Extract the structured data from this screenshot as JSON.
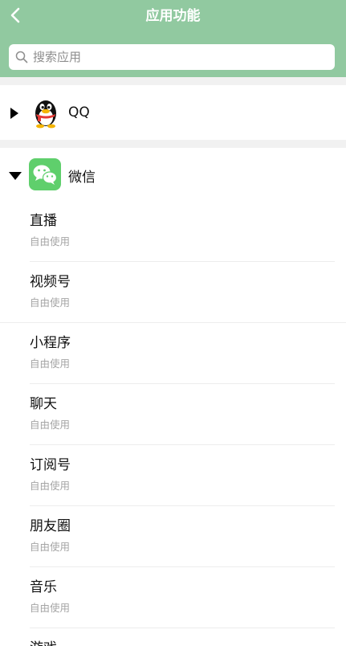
{
  "header": {
    "title": "应用功能",
    "bg_color": "#91c9a0"
  },
  "search": {
    "placeholder": "搜索应用",
    "value": ""
  },
  "apps": [
    {
      "name": "QQ",
      "expanded": false,
      "icon": "qq-penguin-icon"
    },
    {
      "name": "微信",
      "expanded": true,
      "icon": "wechat-icon"
    }
  ],
  "wechat_features": [
    {
      "name": "直播",
      "status": "自由使用"
    },
    {
      "name": "视频号",
      "status": "自由使用"
    },
    {
      "name": "小程序",
      "status": "自由使用"
    },
    {
      "name": "聊天",
      "status": "自由使用"
    },
    {
      "name": "订阅号",
      "status": "自由使用"
    },
    {
      "name": "朋友圈",
      "status": "自由使用"
    },
    {
      "name": "音乐",
      "status": "自由使用"
    },
    {
      "name": "游戏",
      "status": ""
    }
  ]
}
